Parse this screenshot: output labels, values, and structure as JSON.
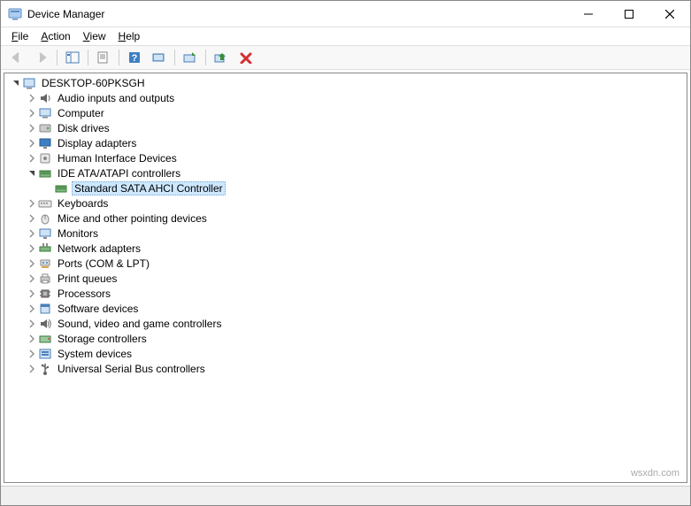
{
  "window": {
    "title": "Device Manager"
  },
  "menu": {
    "file": "File",
    "action": "Action",
    "view": "View",
    "help": "Help"
  },
  "tree": {
    "root": "DESKTOP-60PKSGH",
    "categories": [
      {
        "label": "Audio inputs and outputs",
        "expanded": false,
        "icon": "audio"
      },
      {
        "label": "Computer",
        "expanded": false,
        "icon": "computer"
      },
      {
        "label": "Disk drives",
        "expanded": false,
        "icon": "disk"
      },
      {
        "label": "Display adapters",
        "expanded": false,
        "icon": "display"
      },
      {
        "label": "Human Interface Devices",
        "expanded": false,
        "icon": "hid"
      },
      {
        "label": "IDE ATA/ATAPI controllers",
        "expanded": true,
        "icon": "ide",
        "children": [
          {
            "label": "Standard SATA AHCI Controller",
            "selected": true,
            "icon": "ide"
          }
        ]
      },
      {
        "label": "Keyboards",
        "expanded": false,
        "icon": "keyboard"
      },
      {
        "label": "Mice and other pointing devices",
        "expanded": false,
        "icon": "mouse"
      },
      {
        "label": "Monitors",
        "expanded": false,
        "icon": "monitor"
      },
      {
        "label": "Network adapters",
        "expanded": false,
        "icon": "network"
      },
      {
        "label": "Ports (COM & LPT)",
        "expanded": false,
        "icon": "ports"
      },
      {
        "label": "Print queues",
        "expanded": false,
        "icon": "printer"
      },
      {
        "label": "Processors",
        "expanded": false,
        "icon": "cpu"
      },
      {
        "label": "Software devices",
        "expanded": false,
        "icon": "software"
      },
      {
        "label": "Sound, video and game controllers",
        "expanded": false,
        "icon": "sound"
      },
      {
        "label": "Storage controllers",
        "expanded": false,
        "icon": "storage"
      },
      {
        "label": "System devices",
        "expanded": false,
        "icon": "system"
      },
      {
        "label": "Universal Serial Bus controllers",
        "expanded": false,
        "icon": "usb"
      }
    ]
  },
  "watermark": "wsxdn.com"
}
